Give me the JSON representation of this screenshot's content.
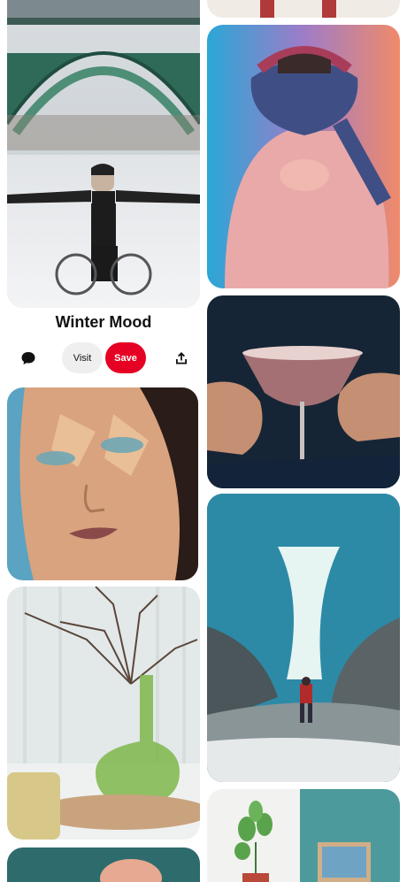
{
  "pin": {
    "title": "Winter Mood",
    "visit_label": "Visit",
    "save_label": "Save"
  },
  "icons": {
    "comment": "comment-icon",
    "share": "share-icon"
  },
  "colors": {
    "save": "#e60023",
    "visit": "#efefef"
  }
}
